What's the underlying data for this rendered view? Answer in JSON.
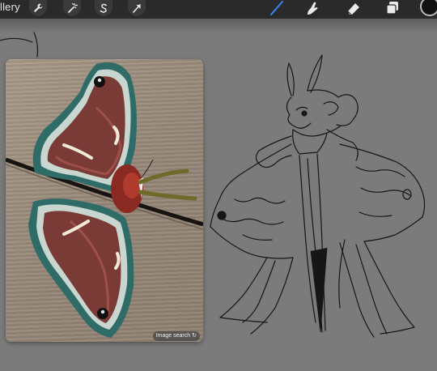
{
  "toolbar": {
    "gallery_label": "llery",
    "actions_icon": "wrench-icon",
    "adjustments_icon": "magic-wand-icon",
    "selection_icon": "selection-s-icon",
    "transform_icon": "arrow-cursor-icon",
    "brush_icon": "brush-icon",
    "smudge_icon": "smudge-finger-icon",
    "eraser_icon": "eraser-icon",
    "layers_icon": "layers-icon",
    "active_tool_color": "#3b82f6",
    "current_color": "#111111"
  },
  "reference": {
    "subject": "moth photo on wood",
    "search_label": "Image search"
  },
  "canvas": {
    "background": "#7b7b7b",
    "content": "moth character pencil sketch"
  }
}
